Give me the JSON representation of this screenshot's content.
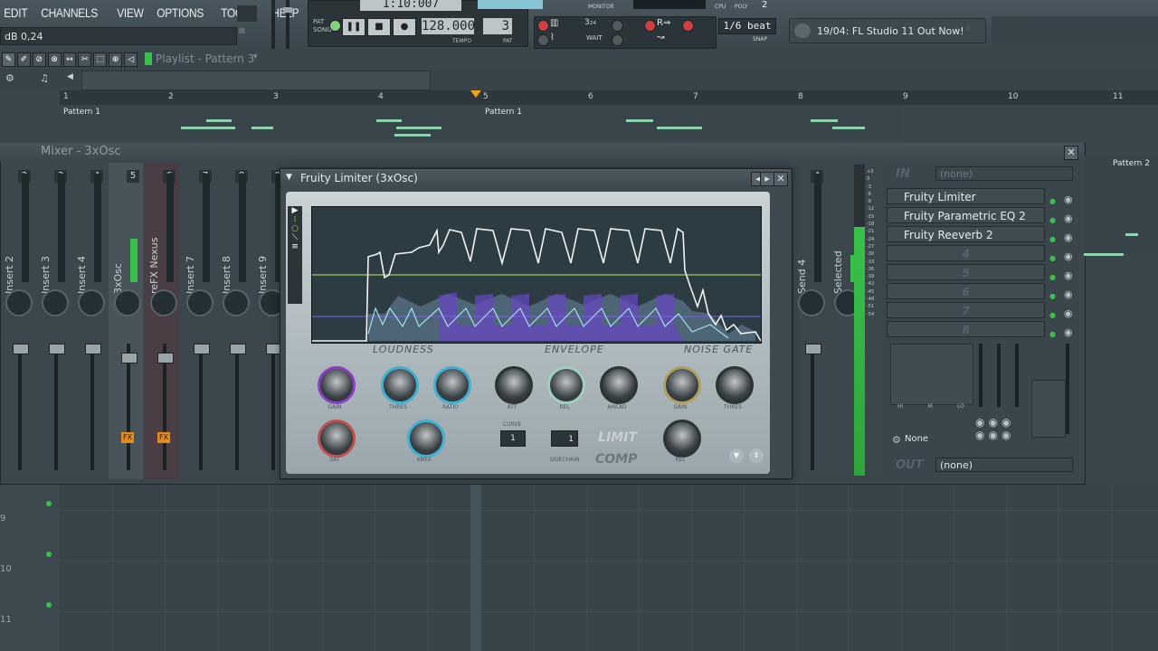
{
  "menu": [
    "EDIT",
    "CHANNELS",
    "VIEW",
    "OPTIONS",
    "TOOLS",
    "HELP"
  ],
  "hint": "dB 0,24",
  "transport": {
    "time": "1:10:007",
    "tempo": "128.000",
    "tempo_label": "TEMPO",
    "pat_value": "3",
    "pat_label": "PAT",
    "pat_song": [
      "PAT",
      "SONG"
    ],
    "monitor": "MONITOR",
    "cpu": "CPU",
    "poly": "POLY",
    "poly_value": "2",
    "snap": "1/6 beat",
    "snap_label": "SNAP",
    "wait": "WAIT"
  },
  "news": "19/04: FL Studio 11 Out Now!",
  "playlist": {
    "title": "Playlist - Pattern 3",
    "timeline": [
      "1",
      "2",
      "3",
      "4",
      "5",
      "6",
      "7",
      "8",
      "9",
      "10",
      "11"
    ],
    "patterns": [
      "Pattern 1",
      "Pattern 1",
      "Pattern 2"
    ],
    "rows": [
      "9",
      "10",
      "11"
    ]
  },
  "mixer": {
    "title": "Mixer - 3xOsc",
    "strips": [
      {
        "num": "2",
        "name": "Insert 2"
      },
      {
        "num": "3",
        "name": "Insert 3"
      },
      {
        "num": "4",
        "name": "Insert 4"
      },
      {
        "num": "5",
        "name": "3xOsc"
      },
      {
        "num": "6",
        "name": "reFX Nexus"
      },
      {
        "num": "7",
        "name": "Insert 7"
      },
      {
        "num": "8",
        "name": "Insert 8"
      },
      {
        "num": "9",
        "name": "Insert 9"
      }
    ],
    "right_strips": [
      {
        "num": "4",
        "name": "Send 4"
      },
      {
        "name": "Selected"
      }
    ],
    "fx_badge": "FX",
    "slots": [
      "Fruity Limiter",
      "Fruity Parametric EQ 2",
      "Fruity Reeverb 2",
      "4",
      "5",
      "6",
      "7",
      "8"
    ],
    "in_label": "IN",
    "in_value": "(none)",
    "out_label": "OUT",
    "out_value": "(none)",
    "eq_bands": [
      "HI",
      "M",
      "LO"
    ],
    "preset": "None",
    "meter_scale": [
      "+3",
      "0",
      "-3",
      "-6",
      "-9",
      "-12",
      "-15",
      "-18",
      "-21",
      "-24",
      "-27",
      "-30",
      "-33",
      "-36",
      "-39",
      "-42",
      "-45",
      "-48",
      "-51",
      "-54"
    ]
  },
  "plugin": {
    "title": "Fruity Limiter (3xOsc)",
    "sections": [
      "LOUDNESS",
      "ENVELOPE",
      "NOISE GATE"
    ],
    "knobs": [
      {
        "label": "GAIN",
        "color": "#8a3fc4"
      },
      {
        "label": "THRES",
        "color": "#3fb0d0"
      },
      {
        "label": "RATIO",
        "color": "#3fb0d0"
      },
      {
        "label": "ATT",
        "color": "#8da3a8"
      },
      {
        "label": "REL",
        "color": "#9fd0c0"
      },
      {
        "label": "AHEAD",
        "color": "#8da3a8"
      },
      {
        "label": "GAIN",
        "color": "#b0a060"
      },
      {
        "label": "THRES",
        "color": "#8da3a8"
      }
    ],
    "knobs2": [
      {
        "label": "SAT",
        "color": "#c05050"
      },
      {
        "label": "KNEE",
        "color": "#3fb0d0"
      },
      {
        "label": "REL",
        "color": "#8da3a8"
      }
    ],
    "curve_label": "CURVE",
    "curve_value": "1",
    "sidechain_label": "SIDECHAIN",
    "sidechain_value": "1",
    "limit": "LIMIT",
    "comp": "COMP"
  }
}
